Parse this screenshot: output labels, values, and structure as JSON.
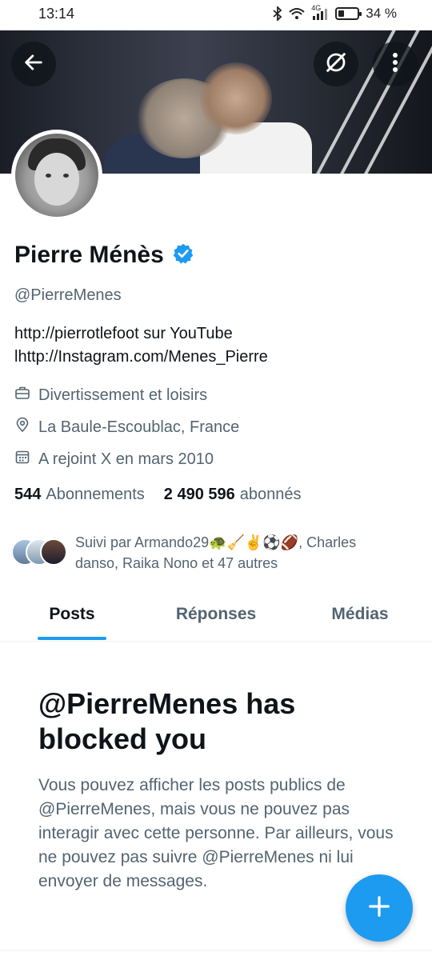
{
  "status_bar": {
    "time": "13:14",
    "network": "4G",
    "battery_percent_label": "34 %",
    "battery_level": 0.34
  },
  "header": {
    "back_icon": "arrow-left-icon",
    "grok_icon": "grok-icon",
    "more_icon": "more-vertical-icon"
  },
  "profile": {
    "name": "Pierre Ménès",
    "verified": true,
    "handle": "@PierreMenes",
    "bio_line1": "http://pierrotlefoot sur YouTube",
    "bio_line2": "lhttp://Instagram.com/Menes_Pierre",
    "category": "Divertissement et loisirs",
    "location": "La Baule-Escoublac, France",
    "joined": "A rejoint X en mars 2010",
    "following_count": "544",
    "following_label": "Abonnements",
    "followers_count": "2 490 596",
    "followers_label": "abonnés",
    "followed_by": "Suivi par Armando29🐢🧹✌️⚽🏈, Charles danso, Raika Nono et 47 autres"
  },
  "tabs": [
    {
      "label": "Posts",
      "active": true
    },
    {
      "label": "Réponses",
      "active": false
    },
    {
      "label": "Médias",
      "active": false
    }
  ],
  "blocked": {
    "title": "@PierreMenes has blocked you",
    "message": "Vous pouvez afficher les posts publics de @PierreMenes, mais vous ne pouvez pas interagir avec cette personne. Par ailleurs, vous ne pouvez pas suivre @PierreMenes ni lui envoyer de messages."
  },
  "fab": {
    "icon": "plus-icon"
  },
  "colors": {
    "accent": "#1d9bf0",
    "text_primary": "#0f1419",
    "text_secondary": "#536471"
  }
}
